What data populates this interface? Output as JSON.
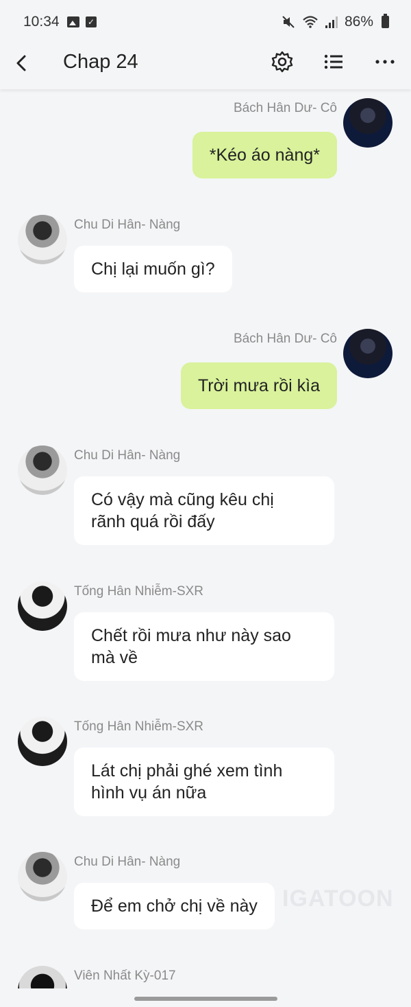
{
  "status": {
    "time": "10:34",
    "battery": "86%",
    "icons": [
      "image-icon",
      "check-icon",
      "mute-icon",
      "wifi-icon",
      "signal-icon",
      "battery-icon"
    ]
  },
  "header": {
    "title": "Chap 24",
    "icons": [
      "back-icon",
      "gear-icon",
      "list-icon",
      "more-icon"
    ]
  },
  "messages": [
    {
      "sender": "Bách Hân Dư- Cô",
      "text": "*Kéo áo nàng*",
      "side": "right"
    },
    {
      "sender": "Chu Di Hân- Nàng",
      "text": "Chị lại muốn gì?",
      "side": "left"
    },
    {
      "sender": "Bách Hân Dư- Cô",
      "text": "Trời mưa rồi kìa",
      "side": "right"
    },
    {
      "sender": "Chu Di Hân- Nàng",
      "text_lines": [
        "Có vậy mà cũng kêu chị",
        "rãnh quá rồi đấy"
      ],
      "side": "left"
    },
    {
      "sender": "Tống Hân Nhiễm-SXR",
      "text_lines": [
        "Chết rồi mưa như này sao",
        "mà về"
      ],
      "side": "left"
    },
    {
      "sender": "Tống Hân Nhiễm-SXR",
      "text_lines": [
        "Lát chị phải ghé xem tình",
        "hình vụ án nữa"
      ],
      "side": "left"
    },
    {
      "sender": "Chu Di Hân- Nàng",
      "text": "Để em chở chị về này",
      "side": "left"
    },
    {
      "sender": "Viên Nhất Kỳ-017",
      "side": "left"
    }
  ],
  "watermark": "IGATOON",
  "colors": {
    "background": "#f4f5f7",
    "my_bubble": "#d9f29b",
    "other_bubble": "#ffffff",
    "sender_text": "#8a8a8a"
  }
}
